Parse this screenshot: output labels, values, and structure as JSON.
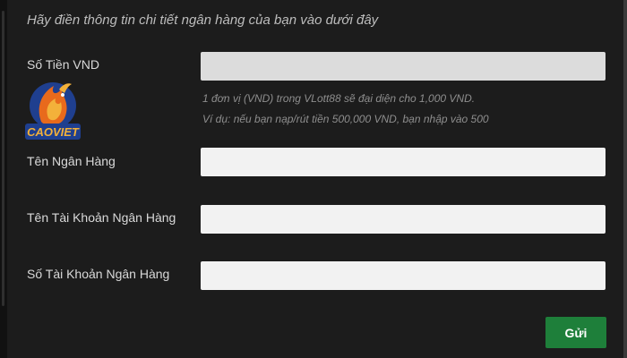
{
  "form": {
    "intro": "Hãy điền thông tin chi tiết ngân hàng của bạn vào dưới đây",
    "amount": {
      "label": "Số Tiền VND",
      "value": "",
      "note_line1": "1 đơn vị (VND) trong VLott88 sẽ đại diện cho 1,000 VND.",
      "note_line2": "Ví dụ: nếu bạn nạp/rút tiền 500,000 VND, bạn nhập vào 500"
    },
    "bank_name": {
      "label": "Tên Ngân Hàng",
      "value": ""
    },
    "account_name": {
      "label": "Tên Tài Khoản Ngân Hàng",
      "value": ""
    },
    "account_number": {
      "label": "Số Tài Khoản Ngân Hàng",
      "value": ""
    },
    "submit_label": "Gửi"
  },
  "logo": {
    "text": "CAOVIET",
    "icon": "phoenix-emblem",
    "colors": {
      "primary": "#e86a1c",
      "secondary": "#1f3f8f",
      "accent": "#f3b13a"
    }
  },
  "colors": {
    "background": "#1c1c1c",
    "field": "#f2f2f2",
    "field_disabled": "#dcdcdc",
    "button": "#1e7f3a"
  }
}
